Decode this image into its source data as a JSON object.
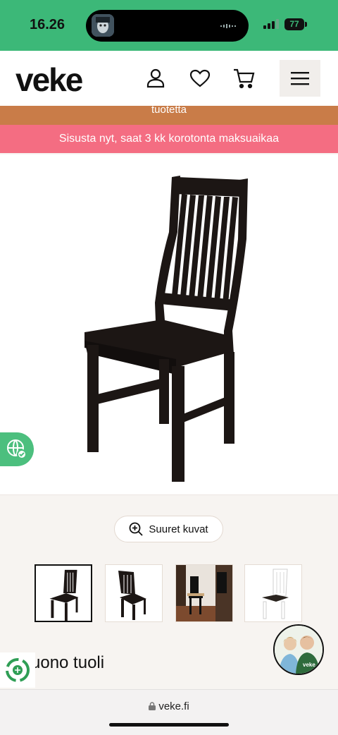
{
  "status_bar": {
    "time": "16.26",
    "battery": "77"
  },
  "header": {
    "logo": "veke",
    "icons": [
      "user-icon",
      "heart-icon",
      "cart-icon",
      "menu-icon"
    ]
  },
  "banners": {
    "partial_text": "tuotetta",
    "promo_text": "Sisusta nyt, saat 3 kk korotonta maksuaikaa"
  },
  "product": {
    "zoom_label": "Suuret kuvat",
    "title": "uono tuoli",
    "thumbnails": [
      "thumb-1",
      "thumb-2",
      "thumb-3",
      "thumb-4"
    ]
  },
  "browser": {
    "url": "veke.fi"
  },
  "colors": {
    "status_green": "#3cb878",
    "banner_orange": "#c97c48",
    "banner_pink": "#f46d82",
    "eco_green": "#4cbf7e"
  }
}
